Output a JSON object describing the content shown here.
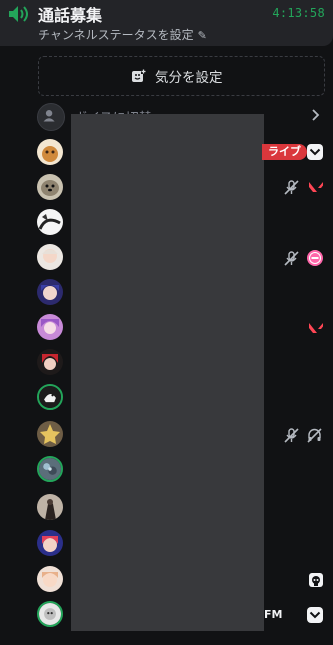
{
  "header": {
    "title": "通話募集",
    "timer": "4:13:58",
    "status": "チャンネルステータスを設定"
  },
  "mood": {
    "label": "気分を設定"
  },
  "voice": {
    "label": "ボイスに切替"
  },
  "badges": {
    "live": "ライブ",
    "fm": "FM"
  },
  "colors": {
    "accent_green": "#23a55a",
    "live_red": "#da373c",
    "valorant_red": "#ff4655",
    "osu_pink": "#ff66aa"
  },
  "icons": [
    "speaker-icon",
    "pencil-icon",
    "add-emoji-icon",
    "chevron-right-icon",
    "chevron-down-icon",
    "mute-icon",
    "deafen-icon",
    "valorant-icon",
    "osu-icon",
    "skull-icon"
  ]
}
